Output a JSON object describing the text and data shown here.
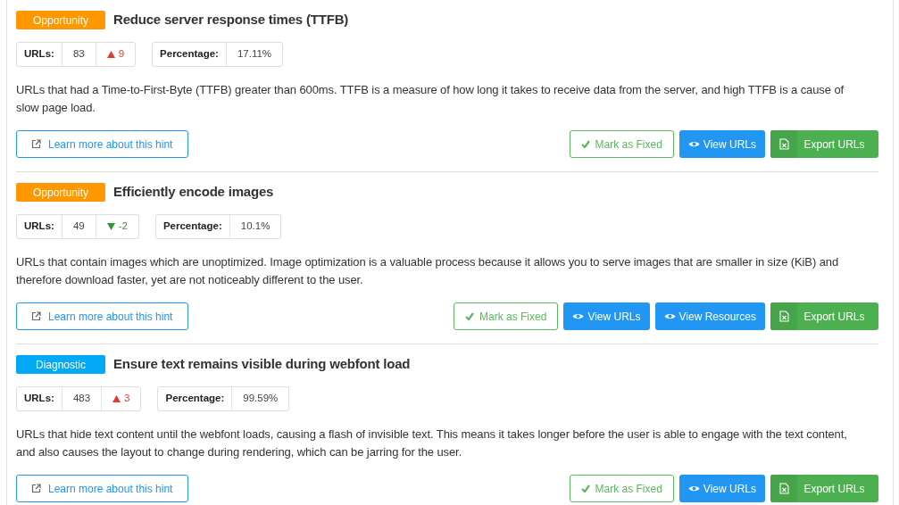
{
  "hints": [
    {
      "category": {
        "label": "Opportunity",
        "kind": "opportunity"
      },
      "title": "Reduce server response times (TTFB)",
      "urls": {
        "label": "URLs:",
        "count": "83",
        "change": {
          "kind": "up",
          "value": "9"
        }
      },
      "percentage": {
        "label": "Percentage:",
        "value": "17.11%"
      },
      "description": "URLs that had a Time-to-First-Byte (TTFB) greater than 600ms. TTFB is a measure of how long it takes to receive data from the server, and high TTFB is a cause of slow page load.",
      "learn_more": "Learn more about this hint",
      "buttons": [
        {
          "kind": "mark_fixed",
          "label": "Mark as Fixed"
        },
        {
          "kind": "view",
          "label": "View URLs"
        },
        {
          "kind": "export",
          "label": "Export URLs"
        }
      ]
    },
    {
      "category": {
        "label": "Opportunity",
        "kind": "opportunity"
      },
      "title": "Efficiently encode images",
      "urls": {
        "label": "URLs:",
        "count": "49",
        "change": {
          "kind": "down",
          "value": "-2"
        }
      },
      "percentage": {
        "label": "Percentage:",
        "value": "10.1%"
      },
      "description": "URLs that contain images which are unoptimized. Image optimization is a valuable process because it allows you to serve images that are smaller in size (KiB) and therefore download faster, yet are not noticeably different to the user.",
      "learn_more": "Learn more about this hint",
      "buttons": [
        {
          "kind": "mark_fixed",
          "label": "Mark as Fixed"
        },
        {
          "kind": "view",
          "label": "View URLs"
        },
        {
          "kind": "view",
          "label": "View Resources"
        },
        {
          "kind": "export",
          "label": "Export URLs"
        }
      ]
    },
    {
      "category": {
        "label": "Diagnostic",
        "kind": "diagnostic"
      },
      "title": "Ensure text remains visible during webfont load",
      "urls": {
        "label": "URLs:",
        "count": "483",
        "change": {
          "kind": "up",
          "value": "3"
        }
      },
      "percentage": {
        "label": "Percentage:",
        "value": "99.59%"
      },
      "description": "URLs that hide text content until the webfont loads, causing a flash of invisible text. This means it takes longer before the user is able to engage with the text content, and also causes the layout to change during rendering, which can be jarring for the user.",
      "learn_more": "Learn more about this hint",
      "buttons": [
        {
          "kind": "mark_fixed",
          "label": "Mark as Fixed"
        },
        {
          "kind": "view",
          "label": "View URLs"
        },
        {
          "kind": "export",
          "label": "Export URLs"
        }
      ]
    }
  ]
}
